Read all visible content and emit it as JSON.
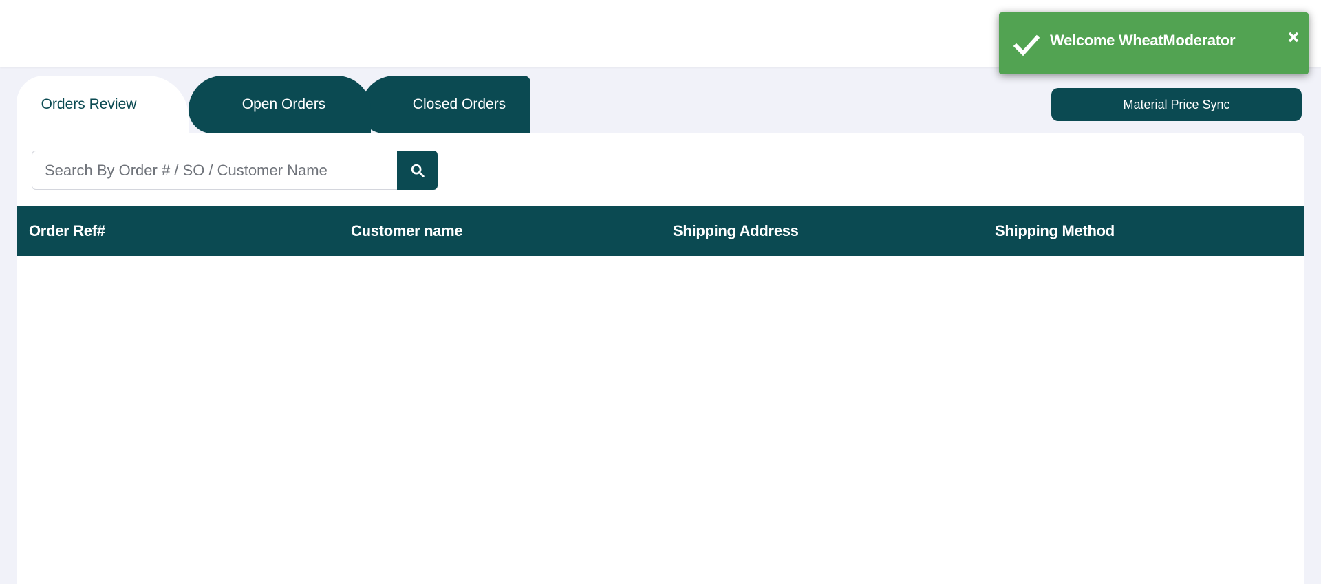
{
  "tabs": [
    {
      "label": "Orders Review",
      "active": true
    },
    {
      "label": "Open Orders",
      "active": false
    },
    {
      "label": "Closed Orders",
      "active": false
    }
  ],
  "actions": {
    "material_price_sync_label": "Material Price Sync"
  },
  "search": {
    "placeholder": "Search By Order # / SO / Customer Name",
    "value": "",
    "button_icon": "search-icon"
  },
  "table": {
    "columns": [
      "Order Ref#",
      "Customer name",
      "Shipping Address",
      "Shipping Method"
    ],
    "rows": []
  },
  "toast": {
    "message": "Welcome WheatModerator",
    "icon": "check-icon",
    "close_icon": "close-icon",
    "color": "#52a352"
  },
  "colors": {
    "brand": "#0b4a52",
    "background": "#f1f2f9",
    "panel": "#ffffff"
  }
}
